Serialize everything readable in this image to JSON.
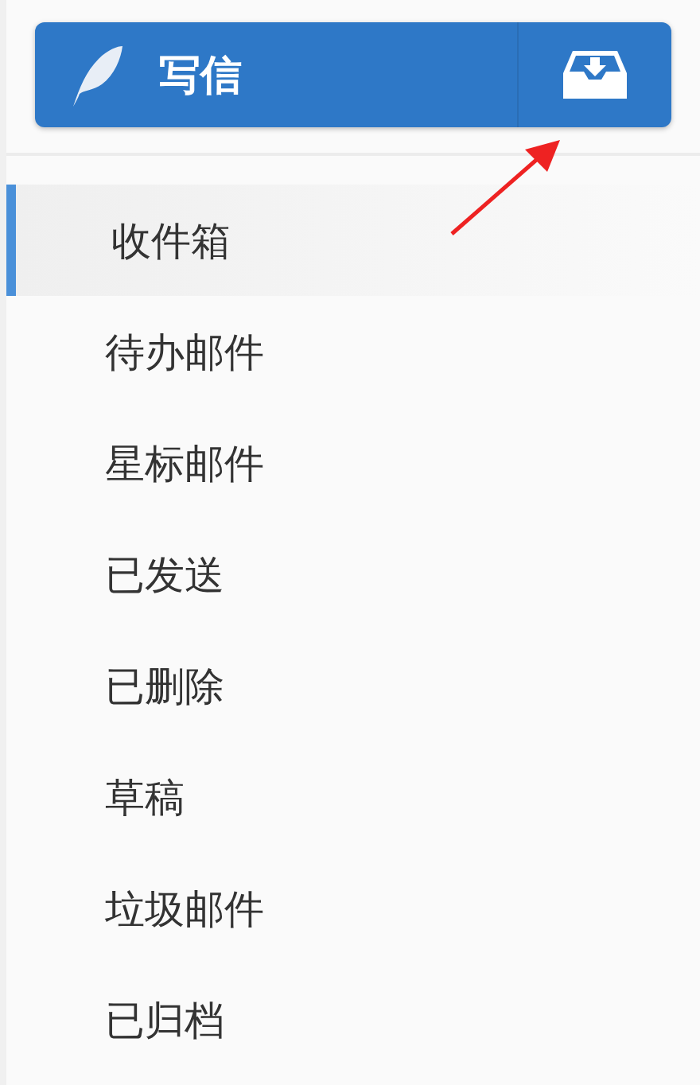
{
  "compose_button": {
    "label": "写信"
  },
  "folders": [
    {
      "label": "收件箱",
      "selected": true
    },
    {
      "label": "待办邮件",
      "selected": false
    },
    {
      "label": "星标邮件",
      "selected": false
    },
    {
      "label": "已发送",
      "selected": false
    },
    {
      "label": "已删除",
      "selected": false
    },
    {
      "label": "草稿",
      "selected": false
    },
    {
      "label": "垃圾邮件",
      "selected": false
    },
    {
      "label": "已归档",
      "selected": false
    }
  ]
}
